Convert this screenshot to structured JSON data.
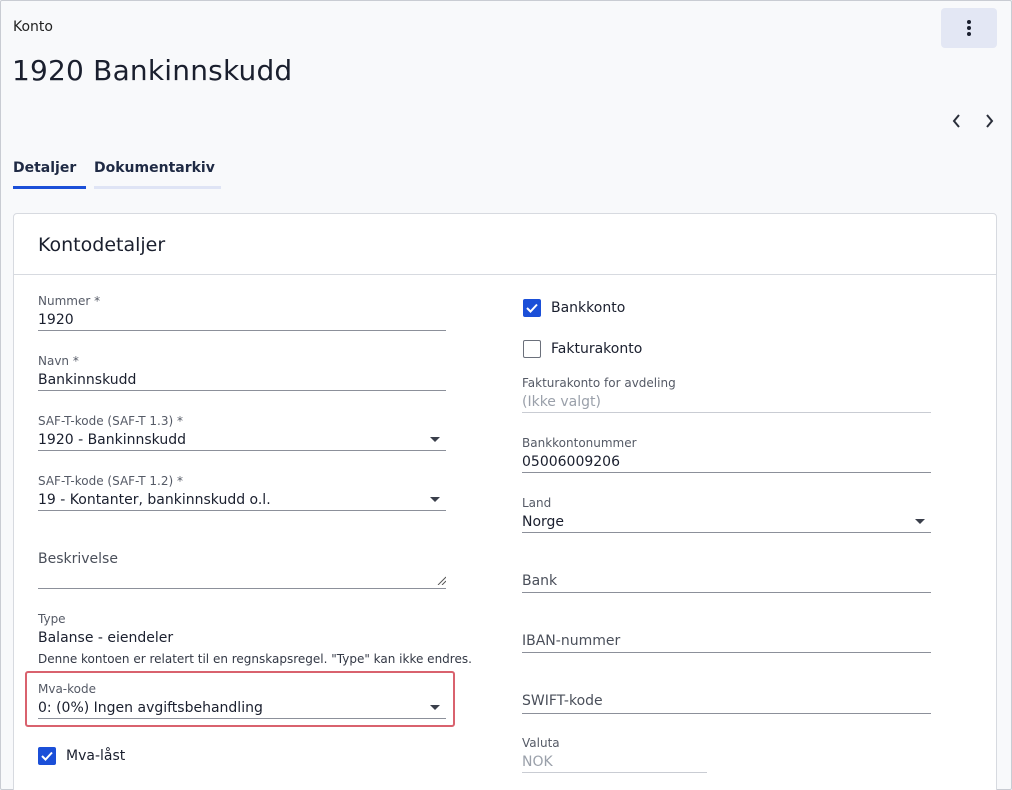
{
  "breadcrumb": "Konto",
  "title": "1920 Bankinnskudd",
  "tabs": [
    {
      "label": "Detaljer",
      "active": true
    },
    {
      "label": "Dokumentarkiv",
      "active": false
    }
  ],
  "card_title": "Kontodetaljer",
  "left": {
    "nummer": {
      "label": "Nummer *",
      "value": "1920"
    },
    "navn": {
      "label": "Navn *",
      "value": "Bankinnskudd"
    },
    "saft13": {
      "label": "SAF-T-kode (SAF-T 1.3) *",
      "value": "1920 - Bankinnskudd"
    },
    "saft12": {
      "label": "SAF-T-kode (SAF-T 1.2) *",
      "value": "19 - Kontanter, bankinnskudd o.l."
    },
    "beskrivelse": {
      "placeholder": "Beskrivelse"
    },
    "type": {
      "label": "Type",
      "value": "Balanse - eiendeler",
      "helper": "Denne kontoen er relatert til en regnskapsregel. \"Type\" kan ikke endres."
    },
    "mva": {
      "label": "Mva-kode",
      "value": "0: (0%) Ingen avgiftsbehandling"
    },
    "mva_last": {
      "label": "Mva-låst",
      "checked": true
    }
  },
  "right": {
    "bankkonto": {
      "label": "Bankkonto",
      "checked": true
    },
    "fakturakonto": {
      "label": "Fakturakonto",
      "checked": false
    },
    "fakturakonto_avd": {
      "label": "Fakturakonto for avdeling",
      "value": "(Ikke valgt)"
    },
    "bankkontonummer": {
      "label": "Bankkontonummer",
      "value": "05006009206"
    },
    "land": {
      "label": "Land",
      "value": "Norge"
    },
    "bank": {
      "placeholder": "Bank"
    },
    "iban": {
      "placeholder": "IBAN-nummer"
    },
    "swift": {
      "placeholder": "SWIFT-kode"
    },
    "valuta": {
      "label": "Valuta",
      "value": "NOK"
    }
  },
  "colors": {
    "accent": "#1b4fd8",
    "highlight": "#d9626e"
  },
  "icons": {
    "menu": "more-vertical-icon",
    "prev": "chevron-left-icon",
    "next": "chevron-right-icon",
    "check": "checkmark-icon",
    "dropdown": "caret-down-icon"
  }
}
